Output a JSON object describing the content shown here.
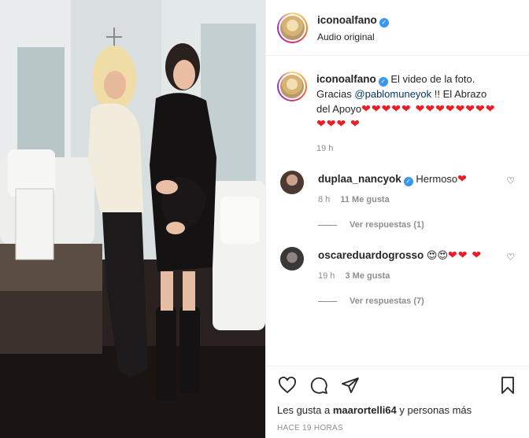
{
  "post": {
    "author": "iconoalfano",
    "audio_label": "Audio original"
  },
  "caption": {
    "username": "iconoalfano",
    "text_before": "El video de la foto. Gracias ",
    "mention": "@pablomuneyok",
    "text_after": " !! El Abrazo del Apoyo",
    "hearts": "❤❤❤❤❤ ❤❤❤❤❤❤❤❤❤❤❤ ❤",
    "time": "19 h"
  },
  "comments": [
    {
      "username": "duplaa_nancyok",
      "text": "Hermoso",
      "hearts": "❤",
      "time": "8 h",
      "likes": "11 Me gusta",
      "replies": "Ver respuestas (1)"
    },
    {
      "username": "oscareduardogrosso",
      "emoji": "😍😍",
      "hearts": "❤❤ ❤",
      "time": "19 h",
      "likes": "3 Me gusta",
      "replies": "Ver respuestas (7)"
    }
  ],
  "footer": {
    "likes_prefix": "Les gusta a ",
    "likes_user": "maarortelli64",
    "likes_suffix": " y personas más",
    "time_ago": "HACE 19 HORAS"
  },
  "icons": {
    "like": "heart-icon",
    "comment": "comment-icon",
    "share": "paper-plane-icon",
    "save": "bookmark-icon",
    "comment_like": "heart-outline-icon",
    "verified": "verified-badge-icon"
  },
  "colors": {
    "verified": "#3897f0",
    "heart": "#ed1c24",
    "link": "#00376b",
    "muted": "#8e8e8e"
  }
}
